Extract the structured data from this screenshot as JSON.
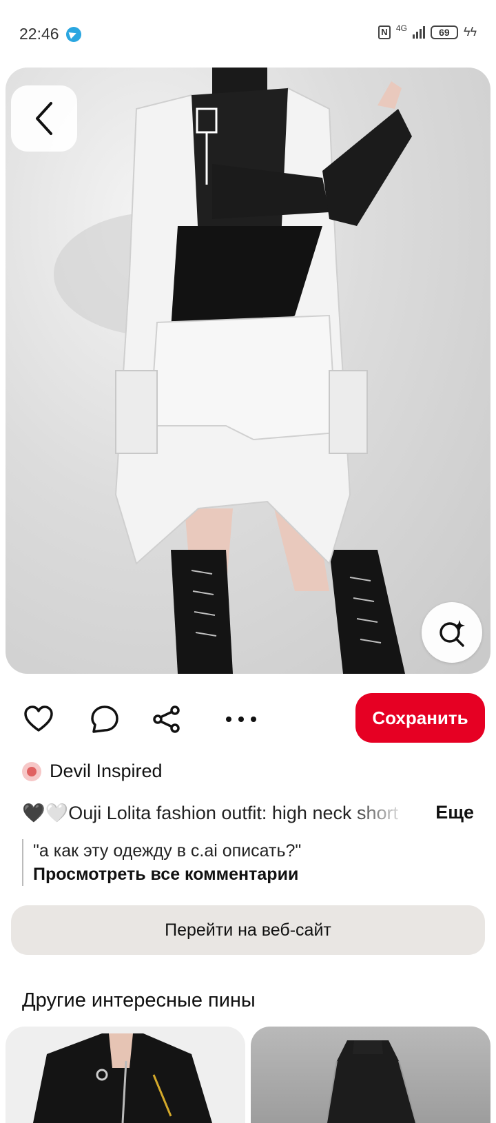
{
  "status_bar": {
    "time": "22:46",
    "network": "4G",
    "battery": "69"
  },
  "pin": {
    "author": "Devil Inspired",
    "description": "🖤🤍Ouji Lolita fashion outfit: high neck short",
    "more_label": "Еще",
    "comment_preview": "\"а как эту одежду в c.ai описать?\"",
    "view_comments_label": "Просмотреть все комментарии",
    "save_label": "Сохранить",
    "website_label": "Перейти на веб-сайт"
  },
  "related": {
    "title": "Другие интересные пины"
  },
  "colors": {
    "accent": "#e60023",
    "secondary_button": "#e9e6e3"
  }
}
